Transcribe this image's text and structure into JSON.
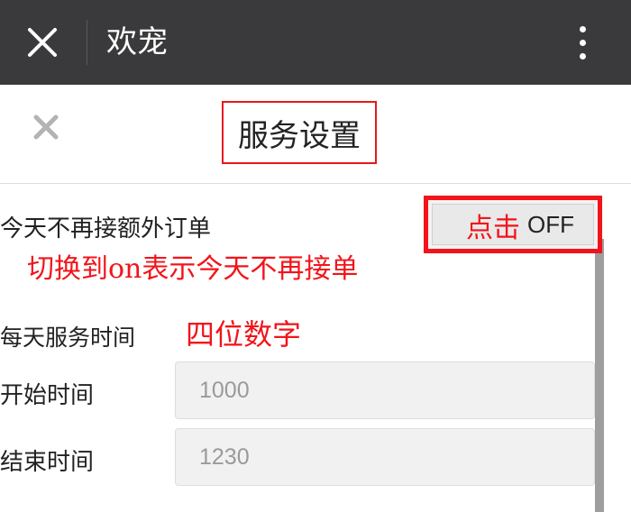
{
  "topbar": {
    "title": "欢宠",
    "close_icon": "close-icon",
    "more_icon": "more-vertical-icon"
  },
  "header": {
    "title": "服务设置",
    "back_icon": "close-icon"
  },
  "settings": {
    "extra_orders_label": "今天不再接额外订单",
    "toggle_state": "OFF",
    "daily_service_label": "每天服务时间",
    "start_label": "开始时间",
    "start_value": "1000",
    "end_label": "结束时间",
    "end_value": "1230"
  },
  "annotations": {
    "click": "点击",
    "switch_hint": "切换到on表示今天不再接单",
    "digits_hint": "四位数字"
  },
  "colors": {
    "topbar": "#3a3a3c",
    "annotation": "#f2141a",
    "input_bg": "#f1f1f1"
  }
}
